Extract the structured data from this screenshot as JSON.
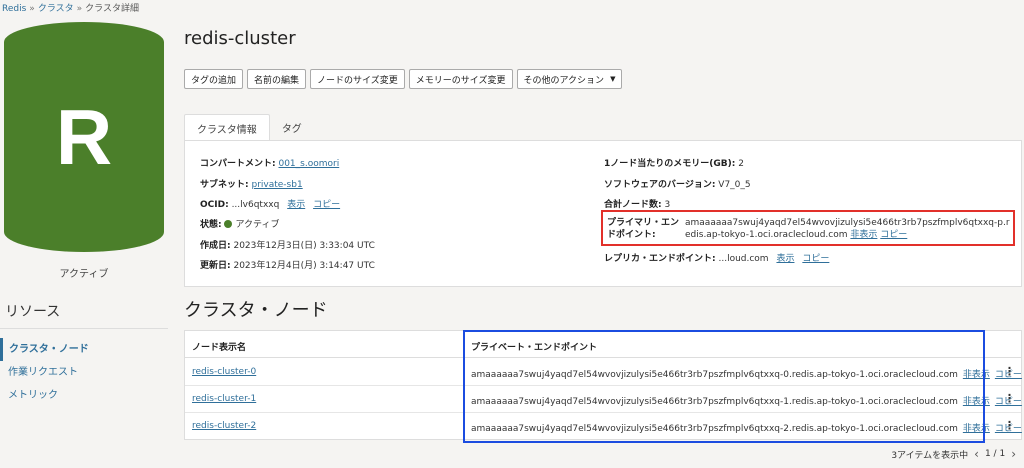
{
  "breadcrumb": [
    "Redis",
    "クラスタ",
    "クラスタ詳細"
  ],
  "avatar": {
    "letter": "R",
    "status": "アクティブ",
    "color": "#4b7f2a"
  },
  "resources": {
    "title": "リソース",
    "items": [
      {
        "label": "クラスタ・ノード",
        "active": true
      },
      {
        "label": "作業リクエスト",
        "active": false
      },
      {
        "label": "メトリック",
        "active": false
      }
    ]
  },
  "title": "redis-cluster",
  "actions": {
    "add_tag": "タグの追加",
    "rename": "名前の編集",
    "resize_nodes": "ノードのサイズ変更",
    "resize_memory": "メモリーのサイズ変更",
    "more": "その他のアクション"
  },
  "tabs": {
    "info": "クラスタ情報",
    "tags": "タグ"
  },
  "info": {
    "compartment_label": "コンパートメント:",
    "compartment_value": "001_s.oomori",
    "subnet_label": "サブネット:",
    "subnet_value": "private-sb1",
    "ocid_label": "OCID:",
    "ocid_value": "...lv6qtxxq",
    "show": "表示",
    "copy": "コピー",
    "hide": "非表示",
    "state_label": "状態:",
    "state_value": "アクティブ",
    "created_label": "作成日:",
    "created_value": "2023年12月3日(日) 3:33:04 UTC",
    "updated_label": "更新日:",
    "updated_value": "2023年12月4日(月) 3:14:47 UTC",
    "memory_label": "1ノード当たりのメモリー(GB):",
    "memory_value": "2",
    "software_label": "ソフトウェアのバージョン:",
    "software_value": "V7_0_5",
    "nodes_label": "合計ノード数:",
    "nodes_value": "3",
    "primary_label": "プライマリ・エンドポイント:",
    "primary_value": "amaaaaaa7swuj4yaqd7el54wvovjizulysi5e466tr3rb7pszfmplv6qtxxq-p.redis.ap-tokyo-1.oci.oraclecloud.com",
    "replica_label": "レプリカ・エンドポイント:",
    "replica_value": "...loud.com"
  },
  "nodes": {
    "section_title": "クラスタ・ノード",
    "col_name": "ノード表示名",
    "col_endpoint": "プライベート・エンドポイント",
    "hide": "非表示",
    "copy": "コピー",
    "rows": [
      {
        "name": "redis-cluster-0",
        "endpoint": "amaaaaaa7swuj4yaqd7el54wvovjizulysi5e466tr3rb7pszfmplv6qtxxq-0.redis.ap-tokyo-1.oci.oraclecloud.com"
      },
      {
        "name": "redis-cluster-1",
        "endpoint": "amaaaaaa7swuj4yaqd7el54wvovjizulysi5e466tr3rb7pszfmplv6qtxxq-1.redis.ap-tokyo-1.oci.oraclecloud.com"
      },
      {
        "name": "redis-cluster-2",
        "endpoint": "amaaaaaa7swuj4yaqd7el54wvovjizulysi5e466tr3rb7pszfmplv6qtxxq-2.redis.ap-tokyo-1.oci.oraclecloud.com"
      }
    ],
    "items_count": "3アイテムを表示中",
    "page": "1 / 1"
  }
}
